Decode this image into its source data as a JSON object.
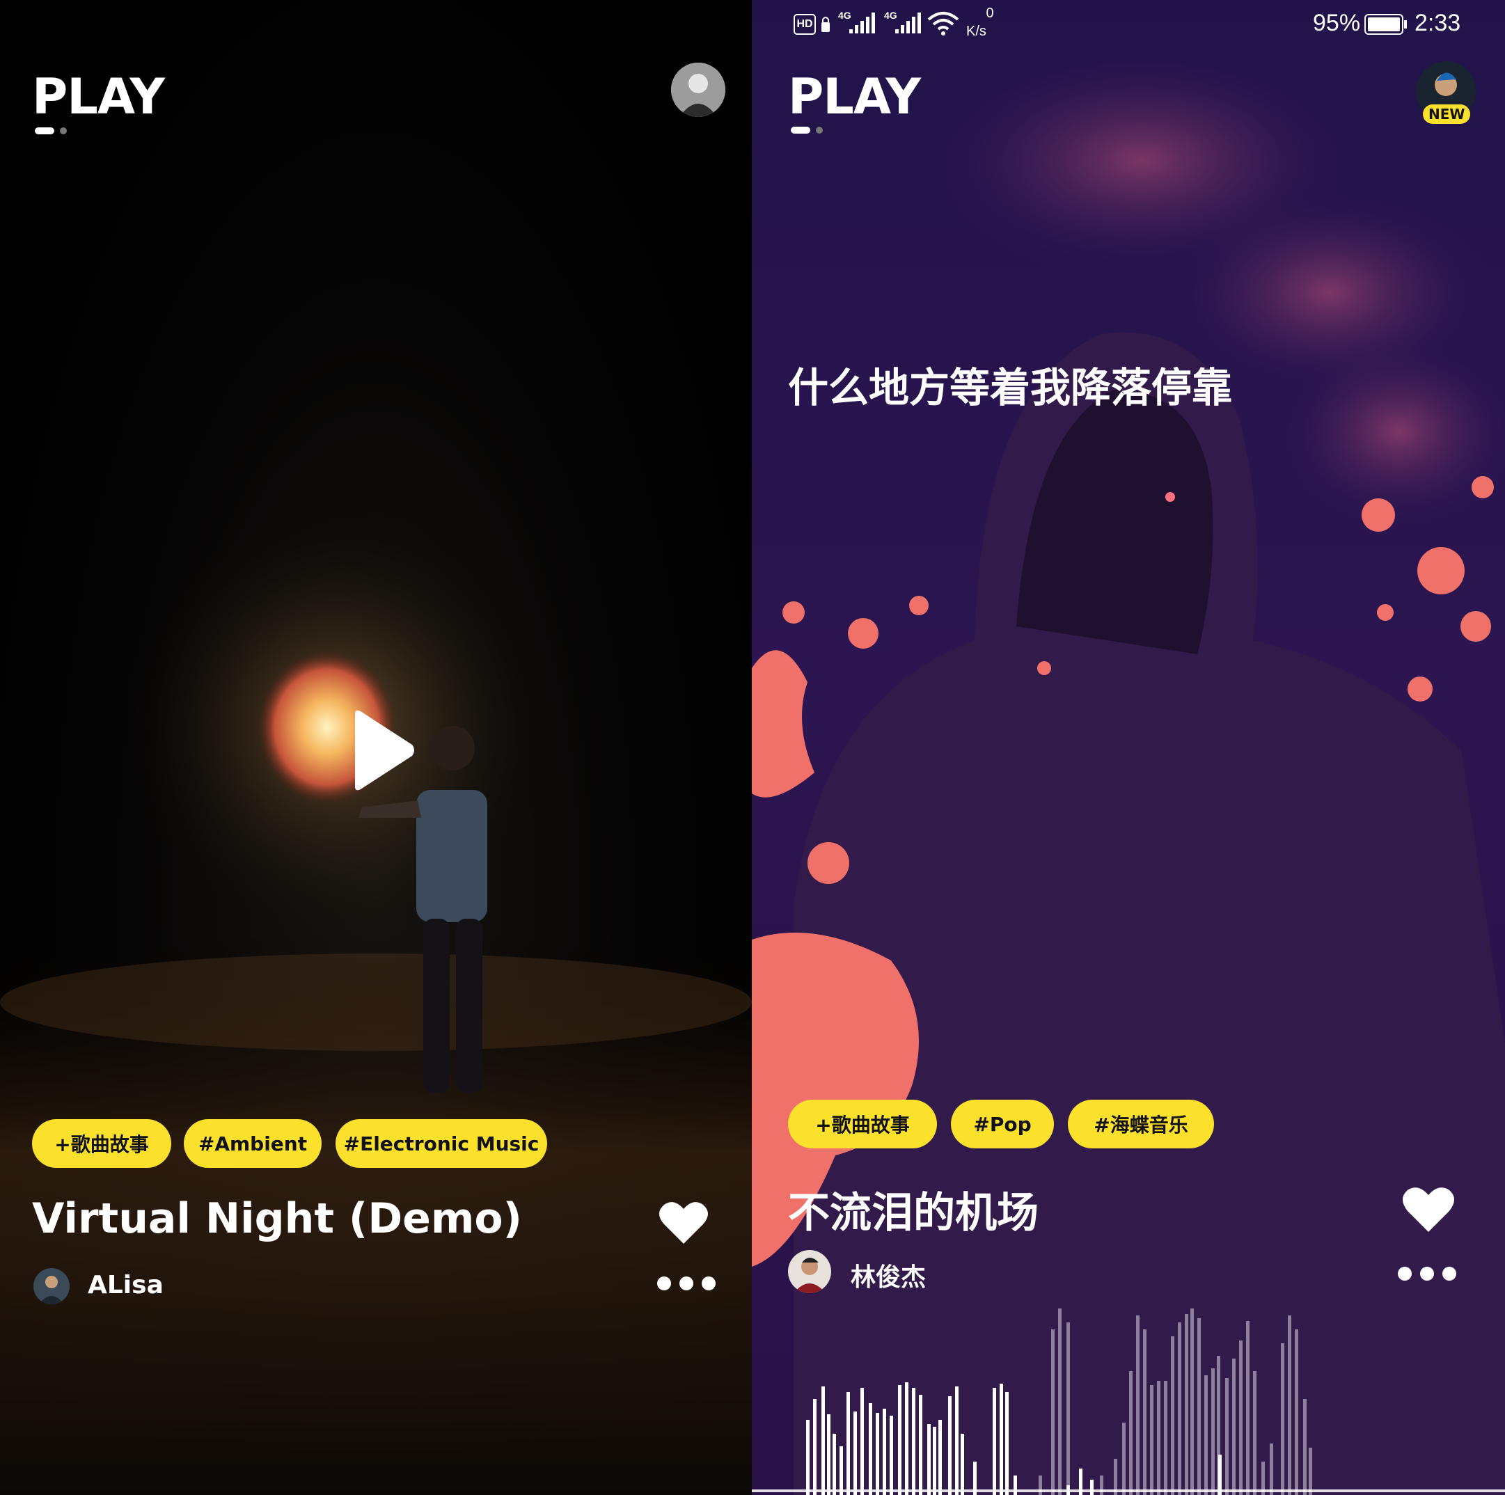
{
  "left": {
    "logo": "PLAY",
    "tags": [
      "+歌曲故事",
      "#Ambient",
      "#Electronic Music"
    ],
    "song_title": "Virtual Night (Demo)",
    "artist": "ALisa",
    "play_icon": "play-icon",
    "heart_icon": "heart-icon",
    "more_icon": "more-icon"
  },
  "right": {
    "status": {
      "hd": "HD",
      "net1": "4G",
      "net2": "4G",
      "speed_value": "0",
      "speed_unit": "K/s",
      "battery": "95%",
      "time": "2:33"
    },
    "logo": "PLAY",
    "new_badge": "NEW",
    "lyric": "什么地方等着我降落停靠",
    "tags": [
      "+歌曲故事",
      "#Pop",
      "#海蝶音乐"
    ],
    "song_title": "不流泪的机场",
    "artist": "林俊杰",
    "accent": "#fbe12c",
    "heart_icon": "heart-icon",
    "more_icon": "more-icon"
  }
}
